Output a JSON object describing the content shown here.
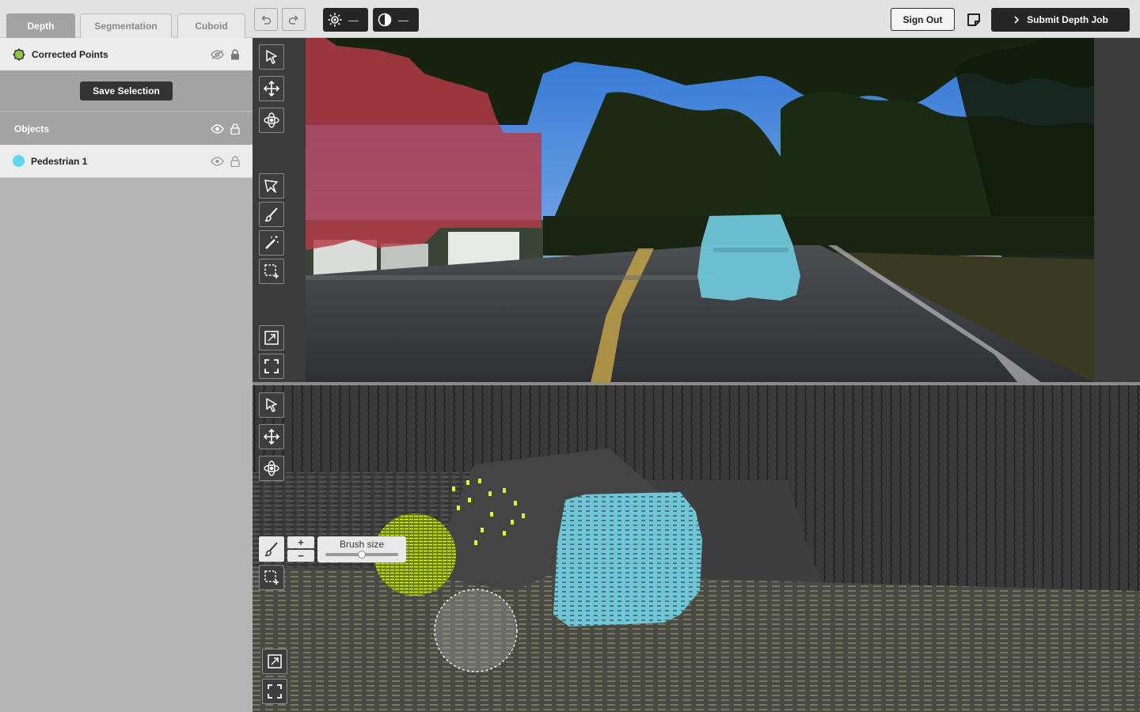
{
  "tabs": [
    {
      "label": "Depth",
      "active": true
    },
    {
      "label": "Segmentation",
      "active": false
    },
    {
      "label": "Cuboid",
      "active": false
    }
  ],
  "toolbar": {
    "undo_icon": "undo-icon",
    "redo_icon": "redo-icon",
    "brightness_value": "—",
    "contrast_value": "—",
    "sign_out_label": "Sign Out",
    "note_icon": "sticky-note-icon",
    "submit_label": "Submit Depth Job"
  },
  "sidebar": {
    "layer": {
      "label": "Corrected Points",
      "icon": "gear-badge-icon",
      "color": "#8bc34a",
      "visible": false,
      "locked": true
    },
    "save_selection_label": "Save Selection",
    "objects_header": "Objects",
    "objects": [
      {
        "label": "Pedestrian 1",
        "color": "#5ed6f0"
      }
    ]
  },
  "brush": {
    "label": "Brush size",
    "plus": "+",
    "minus": "−",
    "value": 0.5
  },
  "colors": {
    "segmentation_red": "#b73a48",
    "object_cyan": "#6fc6d6",
    "corrected_yellow": "#d7ff1a"
  }
}
